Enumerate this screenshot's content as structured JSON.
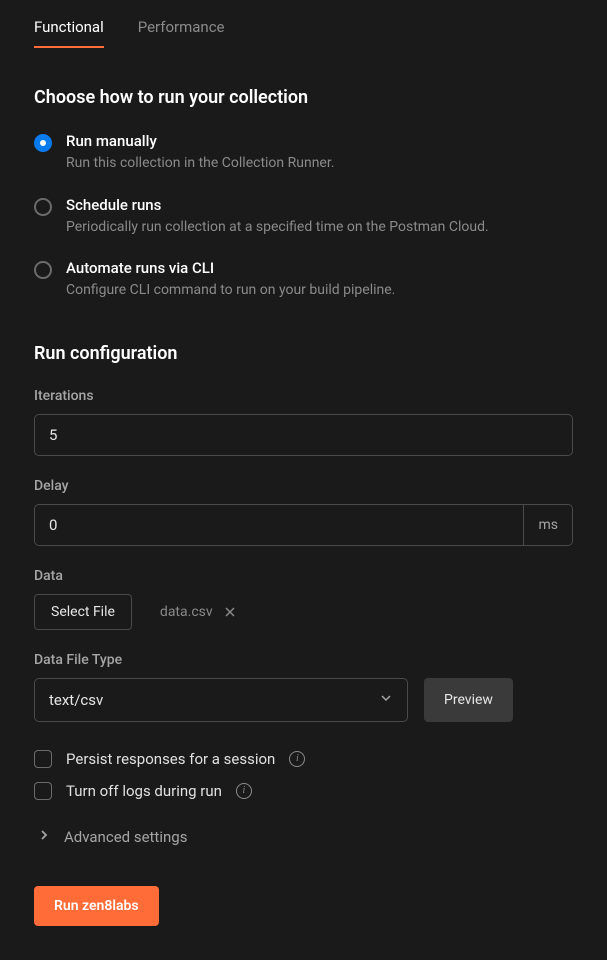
{
  "tabs": {
    "functional": "Functional",
    "performance": "Performance"
  },
  "sections": {
    "choose_title": "Choose how to run your collection",
    "config_title": "Run configuration"
  },
  "run_options": [
    {
      "label": "Run manually",
      "desc": "Run this collection in the Collection Runner.",
      "selected": true
    },
    {
      "label": "Schedule runs",
      "desc": "Periodically run collection at a specified time on the Postman Cloud.",
      "selected": false
    },
    {
      "label": "Automate runs via CLI",
      "desc": "Configure CLI command to run on your build pipeline.",
      "selected": false
    }
  ],
  "fields": {
    "iterations": {
      "label": "Iterations",
      "value": "5"
    },
    "delay": {
      "label": "Delay",
      "value": "0",
      "suffix": "ms"
    },
    "data": {
      "label": "Data",
      "select_file": "Select File",
      "filename": "data.csv"
    },
    "file_type": {
      "label": "Data File Type",
      "value": "text/csv",
      "preview": "Preview"
    }
  },
  "checkboxes": {
    "persist": "Persist responses for a session",
    "turn_off_logs": "Turn off logs during run"
  },
  "advanced": "Advanced settings",
  "run_button": "Run zen8labs"
}
